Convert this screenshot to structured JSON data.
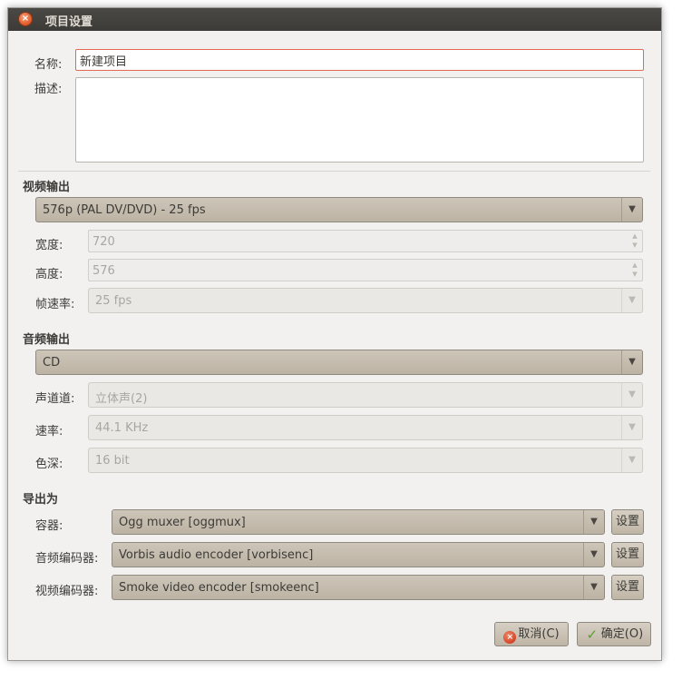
{
  "window": {
    "title": "项目设置",
    "close_icon": "close-icon"
  },
  "project": {
    "name_label": "名称:",
    "name_value": "新建项目",
    "desc_label": "描述:",
    "desc_value": ""
  },
  "video": {
    "section": "视频输出",
    "preset": "576p (PAL DV/DVD) - 25 fps",
    "width_label": "宽度:",
    "width_value": "720",
    "height_label": "高度:",
    "height_value": "576",
    "framerate_label": "帧速率:",
    "framerate_value": "25 fps"
  },
  "audio": {
    "section": "音频输出",
    "preset": "CD",
    "channels_label": "声道道:",
    "channels_value": "立体声(2)",
    "rate_label": "速率:",
    "rate_value": "44.1 KHz",
    "depth_label": "色深:",
    "depth_value": "16 bit"
  },
  "export": {
    "section": "导出为",
    "container_label": "容器:",
    "container_value": "Ogg muxer [oggmux]",
    "audio_encoder_label": "音频编码器:",
    "audio_encoder_value": "Vorbis audio encoder [vorbisenc]",
    "video_encoder_label": "视频编码器:",
    "video_encoder_value": "Smoke video encoder [smokeenc]",
    "settings_label": "设置"
  },
  "buttons": {
    "cancel": "取消(C)",
    "ok": "确定(O)"
  },
  "glyphs": {
    "dropdown": "▼",
    "spin_up": "▲",
    "spin_down": "▼",
    "close": "×",
    "check": "✓"
  },
  "colors": {
    "titlebar": "#3c3b37",
    "window_bg": "#f2f1f0",
    "combo_bg": "#c5bdb0",
    "focus_border": "#e26a53"
  }
}
